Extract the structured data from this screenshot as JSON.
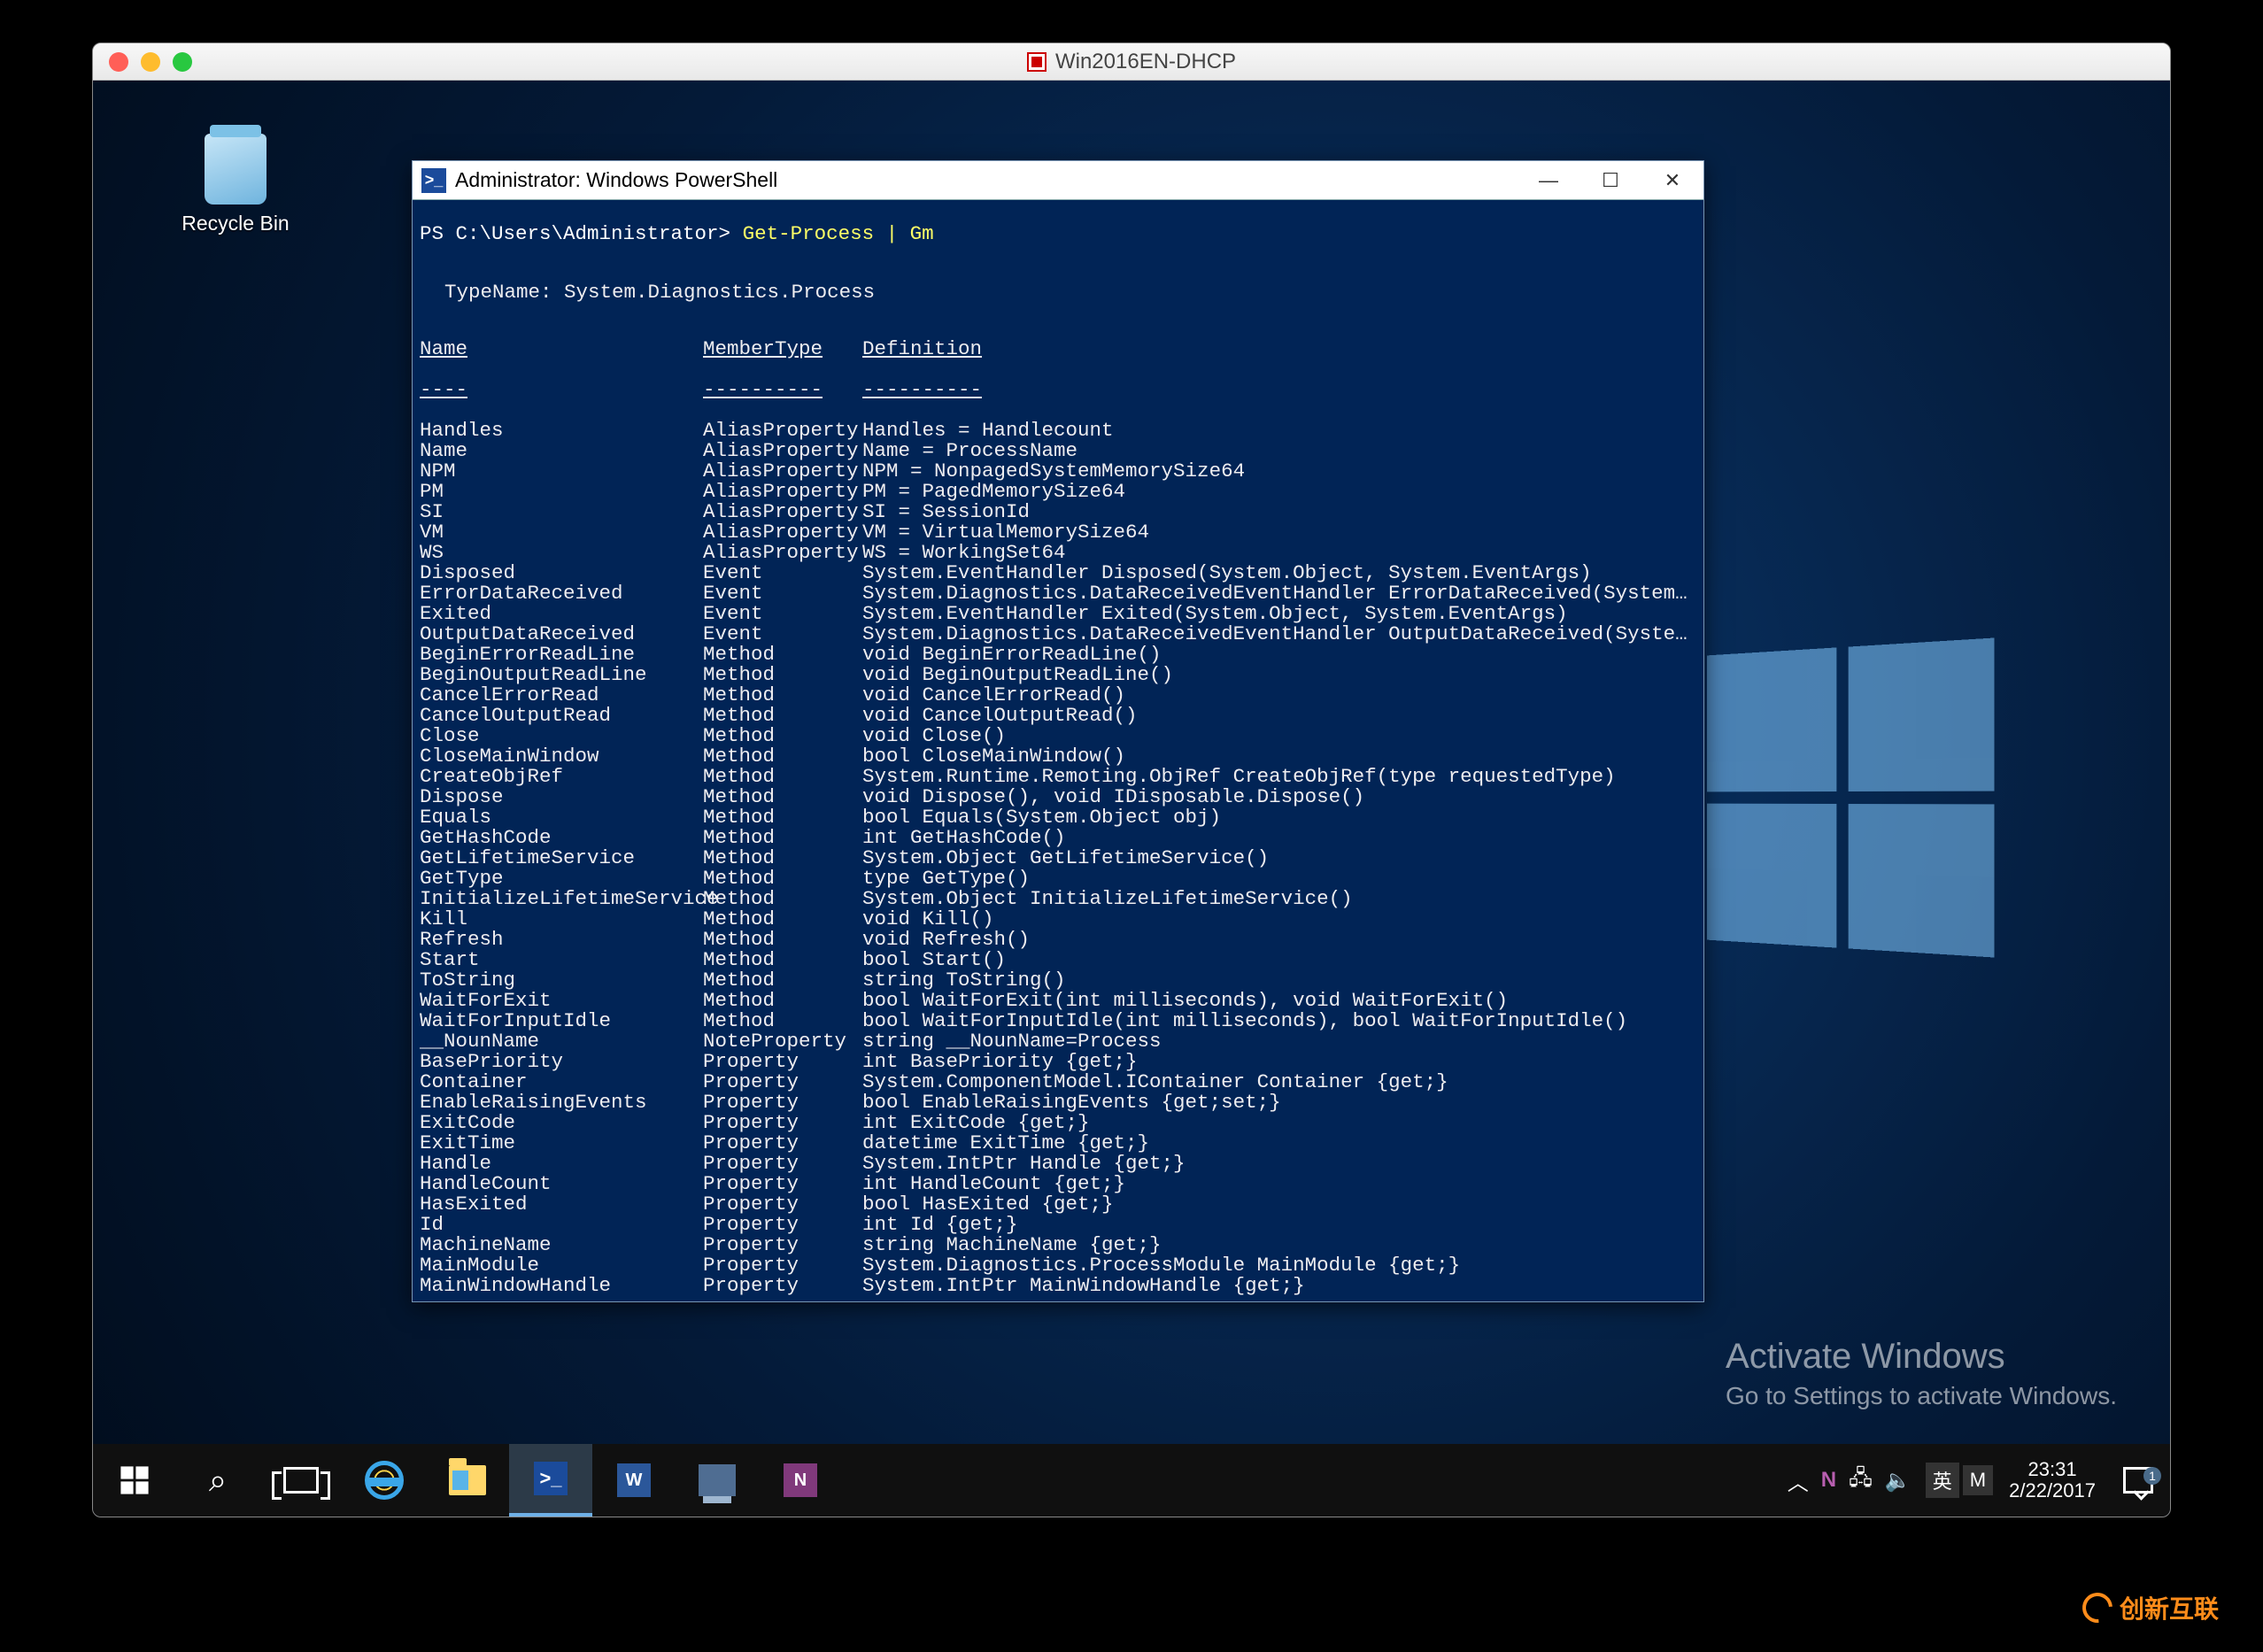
{
  "vm": {
    "title": "Win2016EN-DHCP"
  },
  "desktop": {
    "recycle_label": "Recycle Bin"
  },
  "powershell": {
    "window_title": "Administrator: Windows PowerShell",
    "prompt_path": "PS C:\\Users\\Administrator> ",
    "command": "Get-Process | Gm",
    "typename_line": "TypeName: System.Diagnostics.Process",
    "headers": {
      "name": "Name",
      "membertype": "MemberType",
      "definition": "Definition"
    },
    "rows": [
      {
        "name": "Handles",
        "type": "AliasProperty",
        "def": "Handles = Handlecount"
      },
      {
        "name": "Name",
        "type": "AliasProperty",
        "def": "Name = ProcessName"
      },
      {
        "name": "NPM",
        "type": "AliasProperty",
        "def": "NPM = NonpagedSystemMemorySize64"
      },
      {
        "name": "PM",
        "type": "AliasProperty",
        "def": "PM = PagedMemorySize64"
      },
      {
        "name": "SI",
        "type": "AliasProperty",
        "def": "SI = SessionId"
      },
      {
        "name": "VM",
        "type": "AliasProperty",
        "def": "VM = VirtualMemorySize64"
      },
      {
        "name": "WS",
        "type": "AliasProperty",
        "def": "WS = WorkingSet64"
      },
      {
        "name": "Disposed",
        "type": "Event",
        "def": "System.EventHandler Disposed(System.Object, System.EventArgs)"
      },
      {
        "name": "ErrorDataReceived",
        "type": "Event",
        "def": "System.Diagnostics.DataReceivedEventHandler ErrorDataReceived(System.Objec..."
      },
      {
        "name": "Exited",
        "type": "Event",
        "def": "System.EventHandler Exited(System.Object, System.EventArgs)"
      },
      {
        "name": "OutputDataReceived",
        "type": "Event",
        "def": "System.Diagnostics.DataReceivedEventHandler OutputDataReceived(System.Obje..."
      },
      {
        "name": "BeginErrorReadLine",
        "type": "Method",
        "def": "void BeginErrorReadLine()"
      },
      {
        "name": "BeginOutputReadLine",
        "type": "Method",
        "def": "void BeginOutputReadLine()"
      },
      {
        "name": "CancelErrorRead",
        "type": "Method",
        "def": "void CancelErrorRead()"
      },
      {
        "name": "CancelOutputRead",
        "type": "Method",
        "def": "void CancelOutputRead()"
      },
      {
        "name": "Close",
        "type": "Method",
        "def": "void Close()"
      },
      {
        "name": "CloseMainWindow",
        "type": "Method",
        "def": "bool CloseMainWindow()"
      },
      {
        "name": "CreateObjRef",
        "type": "Method",
        "def": "System.Runtime.Remoting.ObjRef CreateObjRef(type requestedType)"
      },
      {
        "name": "Dispose",
        "type": "Method",
        "def": "void Dispose(), void IDisposable.Dispose()"
      },
      {
        "name": "Equals",
        "type": "Method",
        "def": "bool Equals(System.Object obj)"
      },
      {
        "name": "GetHashCode",
        "type": "Method",
        "def": "int GetHashCode()"
      },
      {
        "name": "GetLifetimeService",
        "type": "Method",
        "def": "System.Object GetLifetimeService()"
      },
      {
        "name": "GetType",
        "type": "Method",
        "def": "type GetType()"
      },
      {
        "name": "InitializeLifetimeService",
        "type": "Method",
        "def": "System.Object InitializeLifetimeService()"
      },
      {
        "name": "Kill",
        "type": "Method",
        "def": "void Kill()"
      },
      {
        "name": "Refresh",
        "type": "Method",
        "def": "void Refresh()"
      },
      {
        "name": "Start",
        "type": "Method",
        "def": "bool Start()"
      },
      {
        "name": "ToString",
        "type": "Method",
        "def": "string ToString()"
      },
      {
        "name": "WaitForExit",
        "type": "Method",
        "def": "bool WaitForExit(int milliseconds), void WaitForExit()"
      },
      {
        "name": "WaitForInputIdle",
        "type": "Method",
        "def": "bool WaitForInputIdle(int milliseconds), bool WaitForInputIdle()"
      },
      {
        "name": "__NounName",
        "type": "NoteProperty",
        "def": "string __NounName=Process"
      },
      {
        "name": "BasePriority",
        "type": "Property",
        "def": "int BasePriority {get;}"
      },
      {
        "name": "Container",
        "type": "Property",
        "def": "System.ComponentModel.IContainer Container {get;}"
      },
      {
        "name": "EnableRaisingEvents",
        "type": "Property",
        "def": "bool EnableRaisingEvents {get;set;}"
      },
      {
        "name": "ExitCode",
        "type": "Property",
        "def": "int ExitCode {get;}"
      },
      {
        "name": "ExitTime",
        "type": "Property",
        "def": "datetime ExitTime {get;}"
      },
      {
        "name": "Handle",
        "type": "Property",
        "def": "System.IntPtr Handle {get;}"
      },
      {
        "name": "HandleCount",
        "type": "Property",
        "def": "int HandleCount {get;}"
      },
      {
        "name": "HasExited",
        "type": "Property",
        "def": "bool HasExited {get;}"
      },
      {
        "name": "Id",
        "type": "Property",
        "def": "int Id {get;}"
      },
      {
        "name": "MachineName",
        "type": "Property",
        "def": "string MachineName {get;}"
      },
      {
        "name": "MainModule",
        "type": "Property",
        "def": "System.Diagnostics.ProcessModule MainModule {get;}"
      },
      {
        "name": "MainWindowHandle",
        "type": "Property",
        "def": "System.IntPtr MainWindowHandle {get;}"
      }
    ]
  },
  "watermark": {
    "line1": "Activate Windows",
    "line2": "Go to Settings to activate Windows."
  },
  "taskbar": {
    "ime_method": "英",
    "ime_layout": "M",
    "time": "23:31",
    "date": "2/22/2017",
    "notif_count": "1"
  },
  "brand": {
    "text": "创新互联"
  }
}
